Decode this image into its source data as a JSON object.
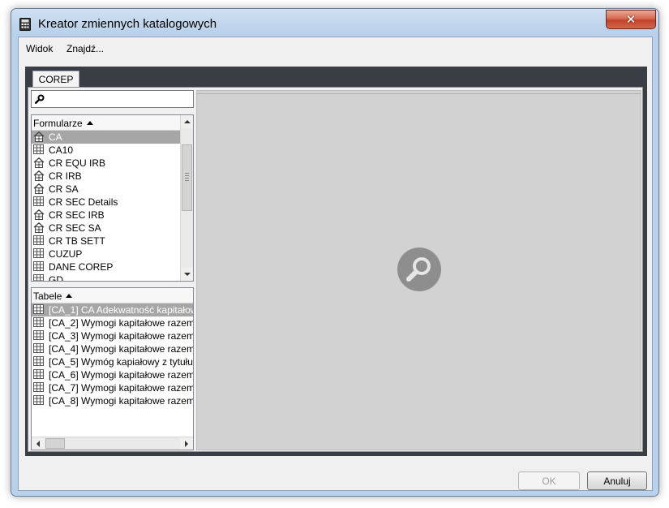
{
  "window": {
    "title": "Kreator zmiennych katalogowych",
    "close_symbol": "✕"
  },
  "menu": {
    "view": "Widok",
    "find": "Znajdź..."
  },
  "tabs": [
    {
      "label": "COREP",
      "active": true
    }
  ],
  "search": {
    "value": "",
    "placeholder": ""
  },
  "forms_list": {
    "header": "Formularze",
    "sort": "ascending",
    "items": [
      {
        "label": "CA",
        "icon": "home-grid-icon",
        "selected": true
      },
      {
        "label": "CA10",
        "icon": "table-grid-icon"
      },
      {
        "label": "CR EQU IRB",
        "icon": "home-grid-icon"
      },
      {
        "label": "CR IRB",
        "icon": "home-grid-icon"
      },
      {
        "label": "CR SA",
        "icon": "home-grid-icon"
      },
      {
        "label": "CR SEC Details",
        "icon": "table-grid-icon"
      },
      {
        "label": "CR SEC IRB",
        "icon": "home-grid-icon"
      },
      {
        "label": "CR SEC SA",
        "icon": "home-grid-icon"
      },
      {
        "label": "CR TB SETT",
        "icon": "table-grid-icon"
      },
      {
        "label": "CUZUP",
        "icon": "table-grid-icon"
      },
      {
        "label": "DANE COREP",
        "icon": "table-grid-icon"
      },
      {
        "label": "GD",
        "icon": "table-grid-icon"
      }
    ]
  },
  "tables_list": {
    "header": "Tabele",
    "sort": "ascending",
    "items": [
      {
        "label": "[CA_1] CA Adekwatność kapitałow",
        "icon": "table-grid-icon",
        "selected": true
      },
      {
        "label": "[CA_2] Wymogi kapitałowe razem",
        "icon": "table-grid-icon"
      },
      {
        "label": "[CA_3] Wymogi kapitałowe razem",
        "icon": "table-grid-icon"
      },
      {
        "label": "[CA_4] Wymogi kapitałowe razem",
        "icon": "table-grid-icon"
      },
      {
        "label": "[CA_5] Wymóg kapiałowy z tytułu",
        "icon": "table-grid-icon"
      },
      {
        "label": "[CA_6] Wymogi kapitałowe razem",
        "icon": "table-grid-icon"
      },
      {
        "label": "[CA_7] Wymogi kapitałowe razem",
        "icon": "table-grid-icon"
      },
      {
        "label": "[CA_8] Wymogi kapitałowe razem",
        "icon": "table-grid-icon"
      }
    ]
  },
  "preview": {
    "icon": "magnifier-icon"
  },
  "footer": {
    "ok_label": "OK",
    "ok_enabled": false,
    "cancel_label": "Anuluj"
  },
  "colors": {
    "title_bar": "#b9d1ea",
    "dark_panel": "#3a3d44",
    "selection": "#a6a6a6",
    "preview_bg": "#d2d2d2",
    "close_button": "#c2432a"
  }
}
